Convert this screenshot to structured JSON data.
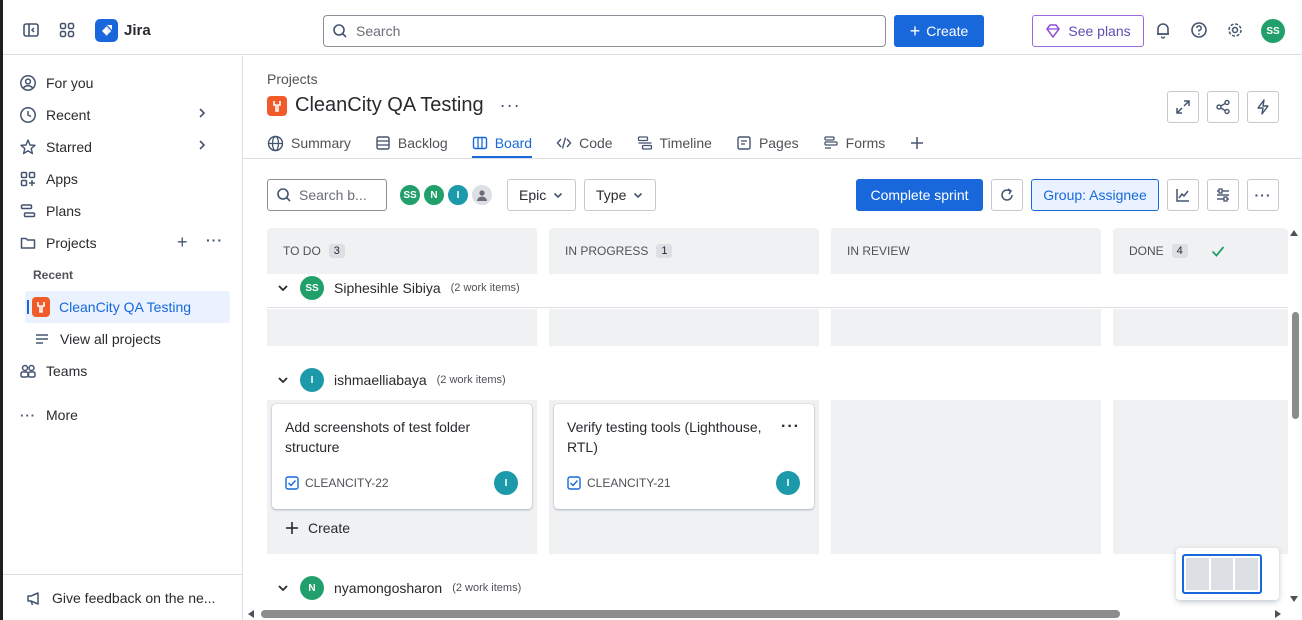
{
  "topnav": {
    "app_name": "Jira",
    "search_placeholder": "Search",
    "create_label": "Create",
    "see_plans_label": "See plans",
    "user_initials": "SS"
  },
  "sidebar": {
    "items": [
      {
        "label": "For you",
        "icon": "user-circle-icon"
      },
      {
        "label": "Recent",
        "icon": "clock-icon"
      },
      {
        "label": "Starred",
        "icon": "star-icon"
      },
      {
        "label": "Apps",
        "icon": "apps-icon"
      },
      {
        "label": "Plans",
        "icon": "plans-icon"
      },
      {
        "label": "Projects",
        "icon": "projects-icon"
      }
    ],
    "recent_heading": "Recent",
    "recent_project": "CleanCity QA Testing",
    "view_all": "View all projects",
    "teams": "Teams",
    "more": "More",
    "feedback": "Give feedback on the ne..."
  },
  "header": {
    "breadcrumb": "Projects",
    "project_name": "CleanCity QA Testing"
  },
  "tabs": [
    {
      "label": "Summary",
      "icon": "globe-icon"
    },
    {
      "label": "Backlog",
      "icon": "backlog-icon"
    },
    {
      "label": "Board",
      "icon": "board-icon",
      "active": true
    },
    {
      "label": "Code",
      "icon": "code-icon"
    },
    {
      "label": "Timeline",
      "icon": "timeline-icon"
    },
    {
      "label": "Pages",
      "icon": "pages-icon"
    },
    {
      "label": "Forms",
      "icon": "forms-icon"
    }
  ],
  "toolbar": {
    "search_placeholder": "Search b...",
    "avatars": [
      {
        "initials": "SS",
        "color": "#22a06b"
      },
      {
        "initials": "N",
        "color": "#22a06b"
      },
      {
        "initials": "I",
        "color": "#1d9aaa"
      }
    ],
    "epic_label": "Epic",
    "type_label": "Type",
    "complete_sprint": "Complete sprint",
    "group_label": "Group: Assignee"
  },
  "columns": [
    {
      "name": "TO DO",
      "count": "3"
    },
    {
      "name": "IN PROGRESS",
      "count": "1"
    },
    {
      "name": "IN REVIEW",
      "count": ""
    },
    {
      "name": "DONE",
      "count": "4"
    }
  ],
  "swimlanes": [
    {
      "name": "Siphesihle Sibiya",
      "sub": "(2 work items)",
      "initials": "SS",
      "color": "#22a06b"
    },
    {
      "name": "ishmaelliabaya",
      "sub": "(2 work items)",
      "initials": "I",
      "color": "#1d9aaa"
    },
    {
      "name": "nyamongosharon",
      "sub": "(2 work items)",
      "initials": "N",
      "color": "#22a06b"
    }
  ],
  "cards": [
    {
      "title": "Add screenshots of test folder structure",
      "key": "CLEANCITY-22",
      "assignee": "I"
    },
    {
      "title": "Verify testing tools (Lighthouse, RTL)",
      "key": "CLEANCITY-21",
      "assignee": "I"
    }
  ],
  "create_label": "Create",
  "colors": {
    "accent": "#1868db",
    "project_icon": "#f15b2a"
  }
}
